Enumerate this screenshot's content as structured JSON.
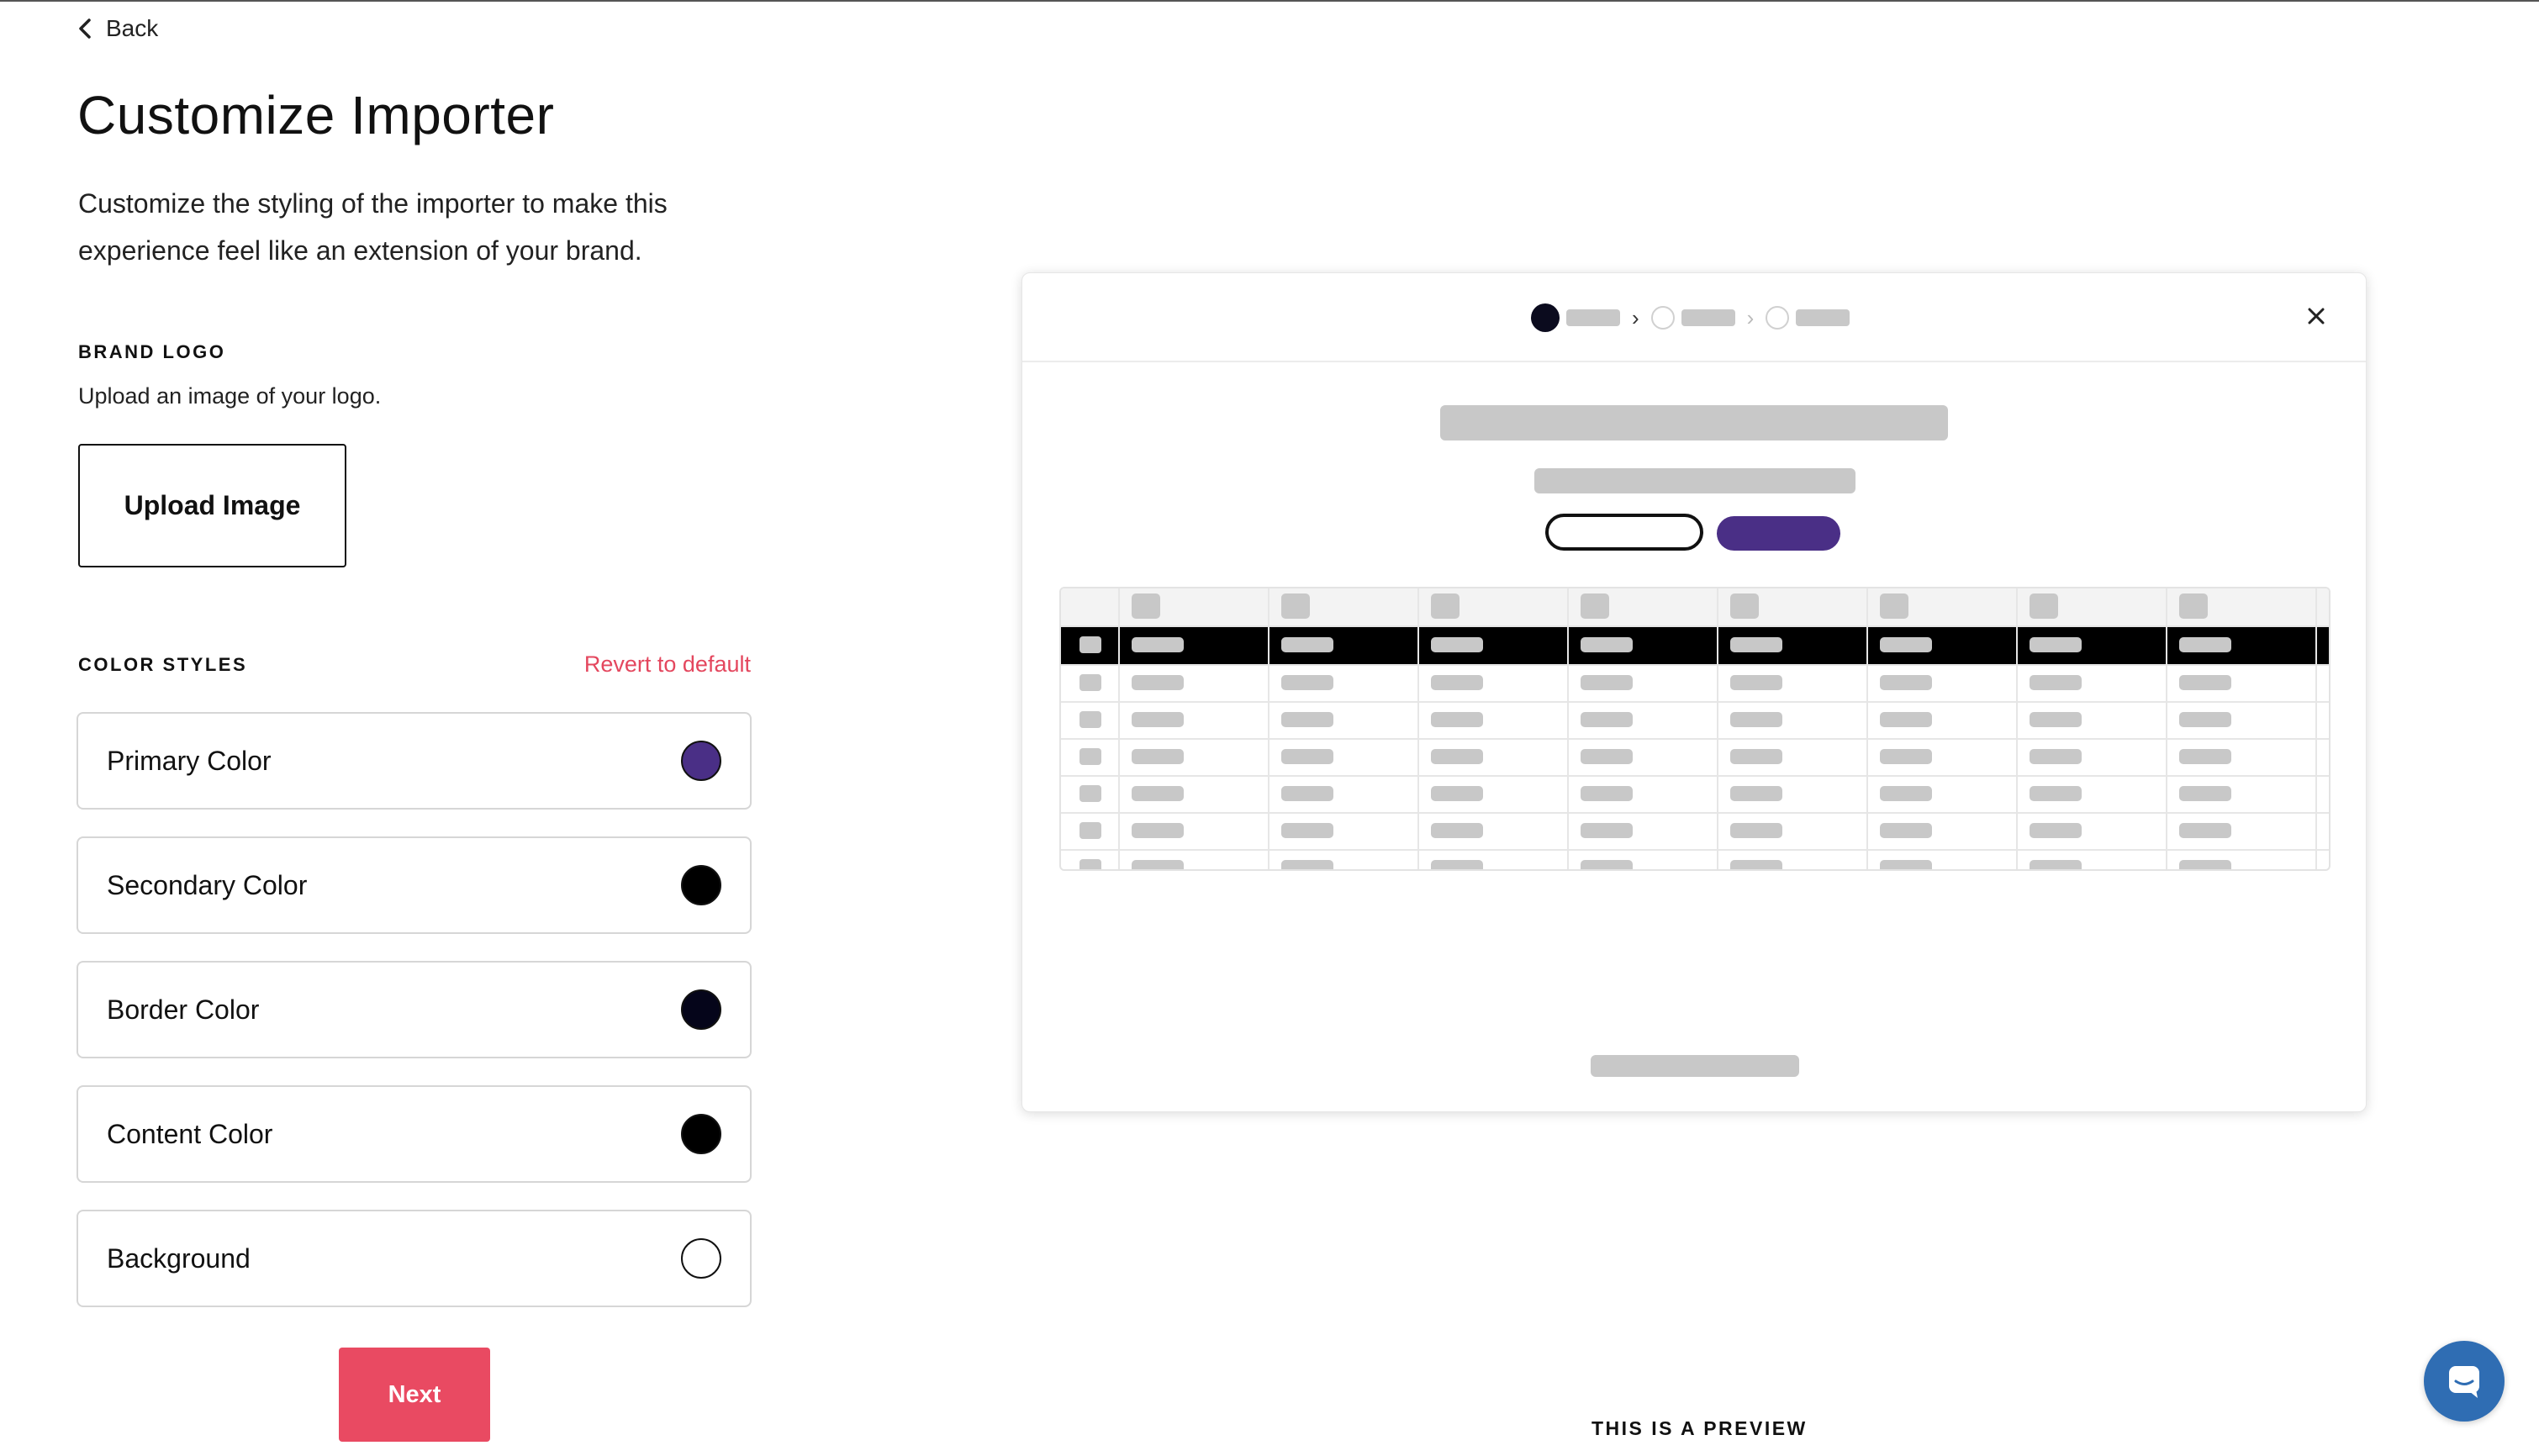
{
  "nav": {
    "back_label": "Back"
  },
  "page": {
    "title": "Customize Importer",
    "description": "Customize the styling of the importer to make this experience feel like an extension of your brand."
  },
  "brand_logo": {
    "section_label": "BRAND LOGO",
    "help_text": "Upload an image of your logo.",
    "upload_button_label": "Upload Image"
  },
  "color_styles": {
    "section_label": "COLOR STYLES",
    "revert_label": "Revert to default",
    "items": [
      {
        "label": "Primary Color",
        "color": "#4a2f86"
      },
      {
        "label": "Secondary Color",
        "color": "#000000"
      },
      {
        "label": "Border Color",
        "color": "#05051a"
      },
      {
        "label": "Content Color",
        "color": "#000000"
      },
      {
        "label": "Background",
        "color": "#ffffff"
      }
    ]
  },
  "actions": {
    "next_label": "Next"
  },
  "preview": {
    "caption": "THIS IS A PREVIEW",
    "primary_color": "#4a2f86",
    "close_icon": "close-icon",
    "stepper_steps": 3,
    "active_step": 1
  },
  "support": {
    "chat_icon": "chat-bubble-icon",
    "chat_color": "#2f6db3"
  },
  "accent_color": "#e94a62"
}
